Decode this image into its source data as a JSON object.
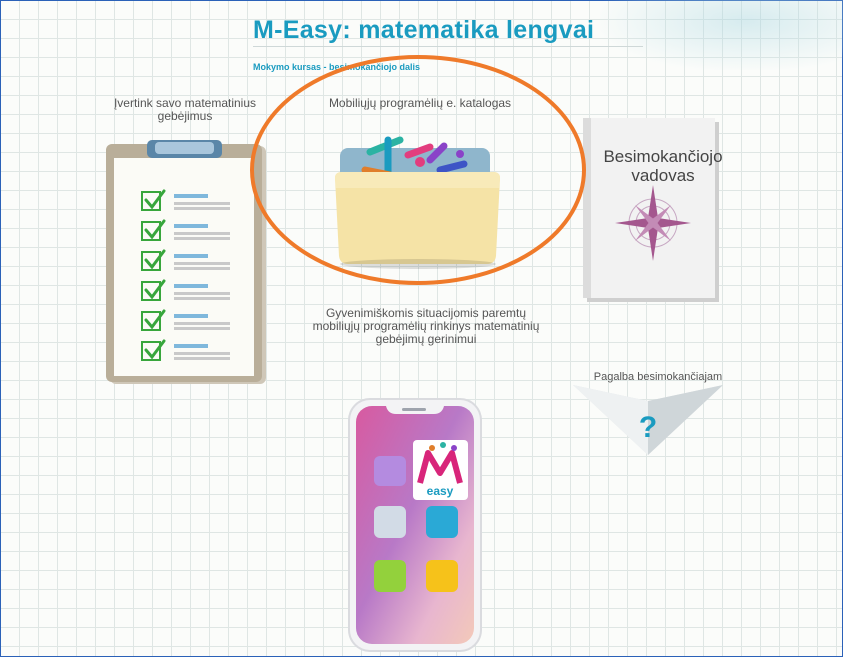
{
  "header": {
    "title": "M-Easy: matematika lengvai",
    "breadcrumb": "Mokymo kursas - besimokančiojo dalis"
  },
  "tiles": {
    "assess": {
      "label": "Įvertink savo matematinius gebėjimus",
      "icon": "clipboard-checklist-icon"
    },
    "catalog": {
      "label": "Mobiliųjų programėlių e. katalogas",
      "icon": "folder-icon"
    },
    "guide": {
      "label": "Besimokančiojo vadovas",
      "icon": "book-compass-icon"
    },
    "collection": {
      "label": "Gyvenimiškomis situacijomis paremtų mobiliųjų programėlių rinkinys matematinių gebėjimų gerinimui",
      "icon": "smartphone-icon"
    },
    "help": {
      "label": "Pagalba besimokančiajam",
      "icon": "question-mark-icon",
      "symbol": "?"
    }
  },
  "app_icon": {
    "text": "easy"
  },
  "colors": {
    "accent": "#1a9bc0",
    "highlight_ellipse": "#ef7a2a",
    "check": "#38a63c"
  }
}
